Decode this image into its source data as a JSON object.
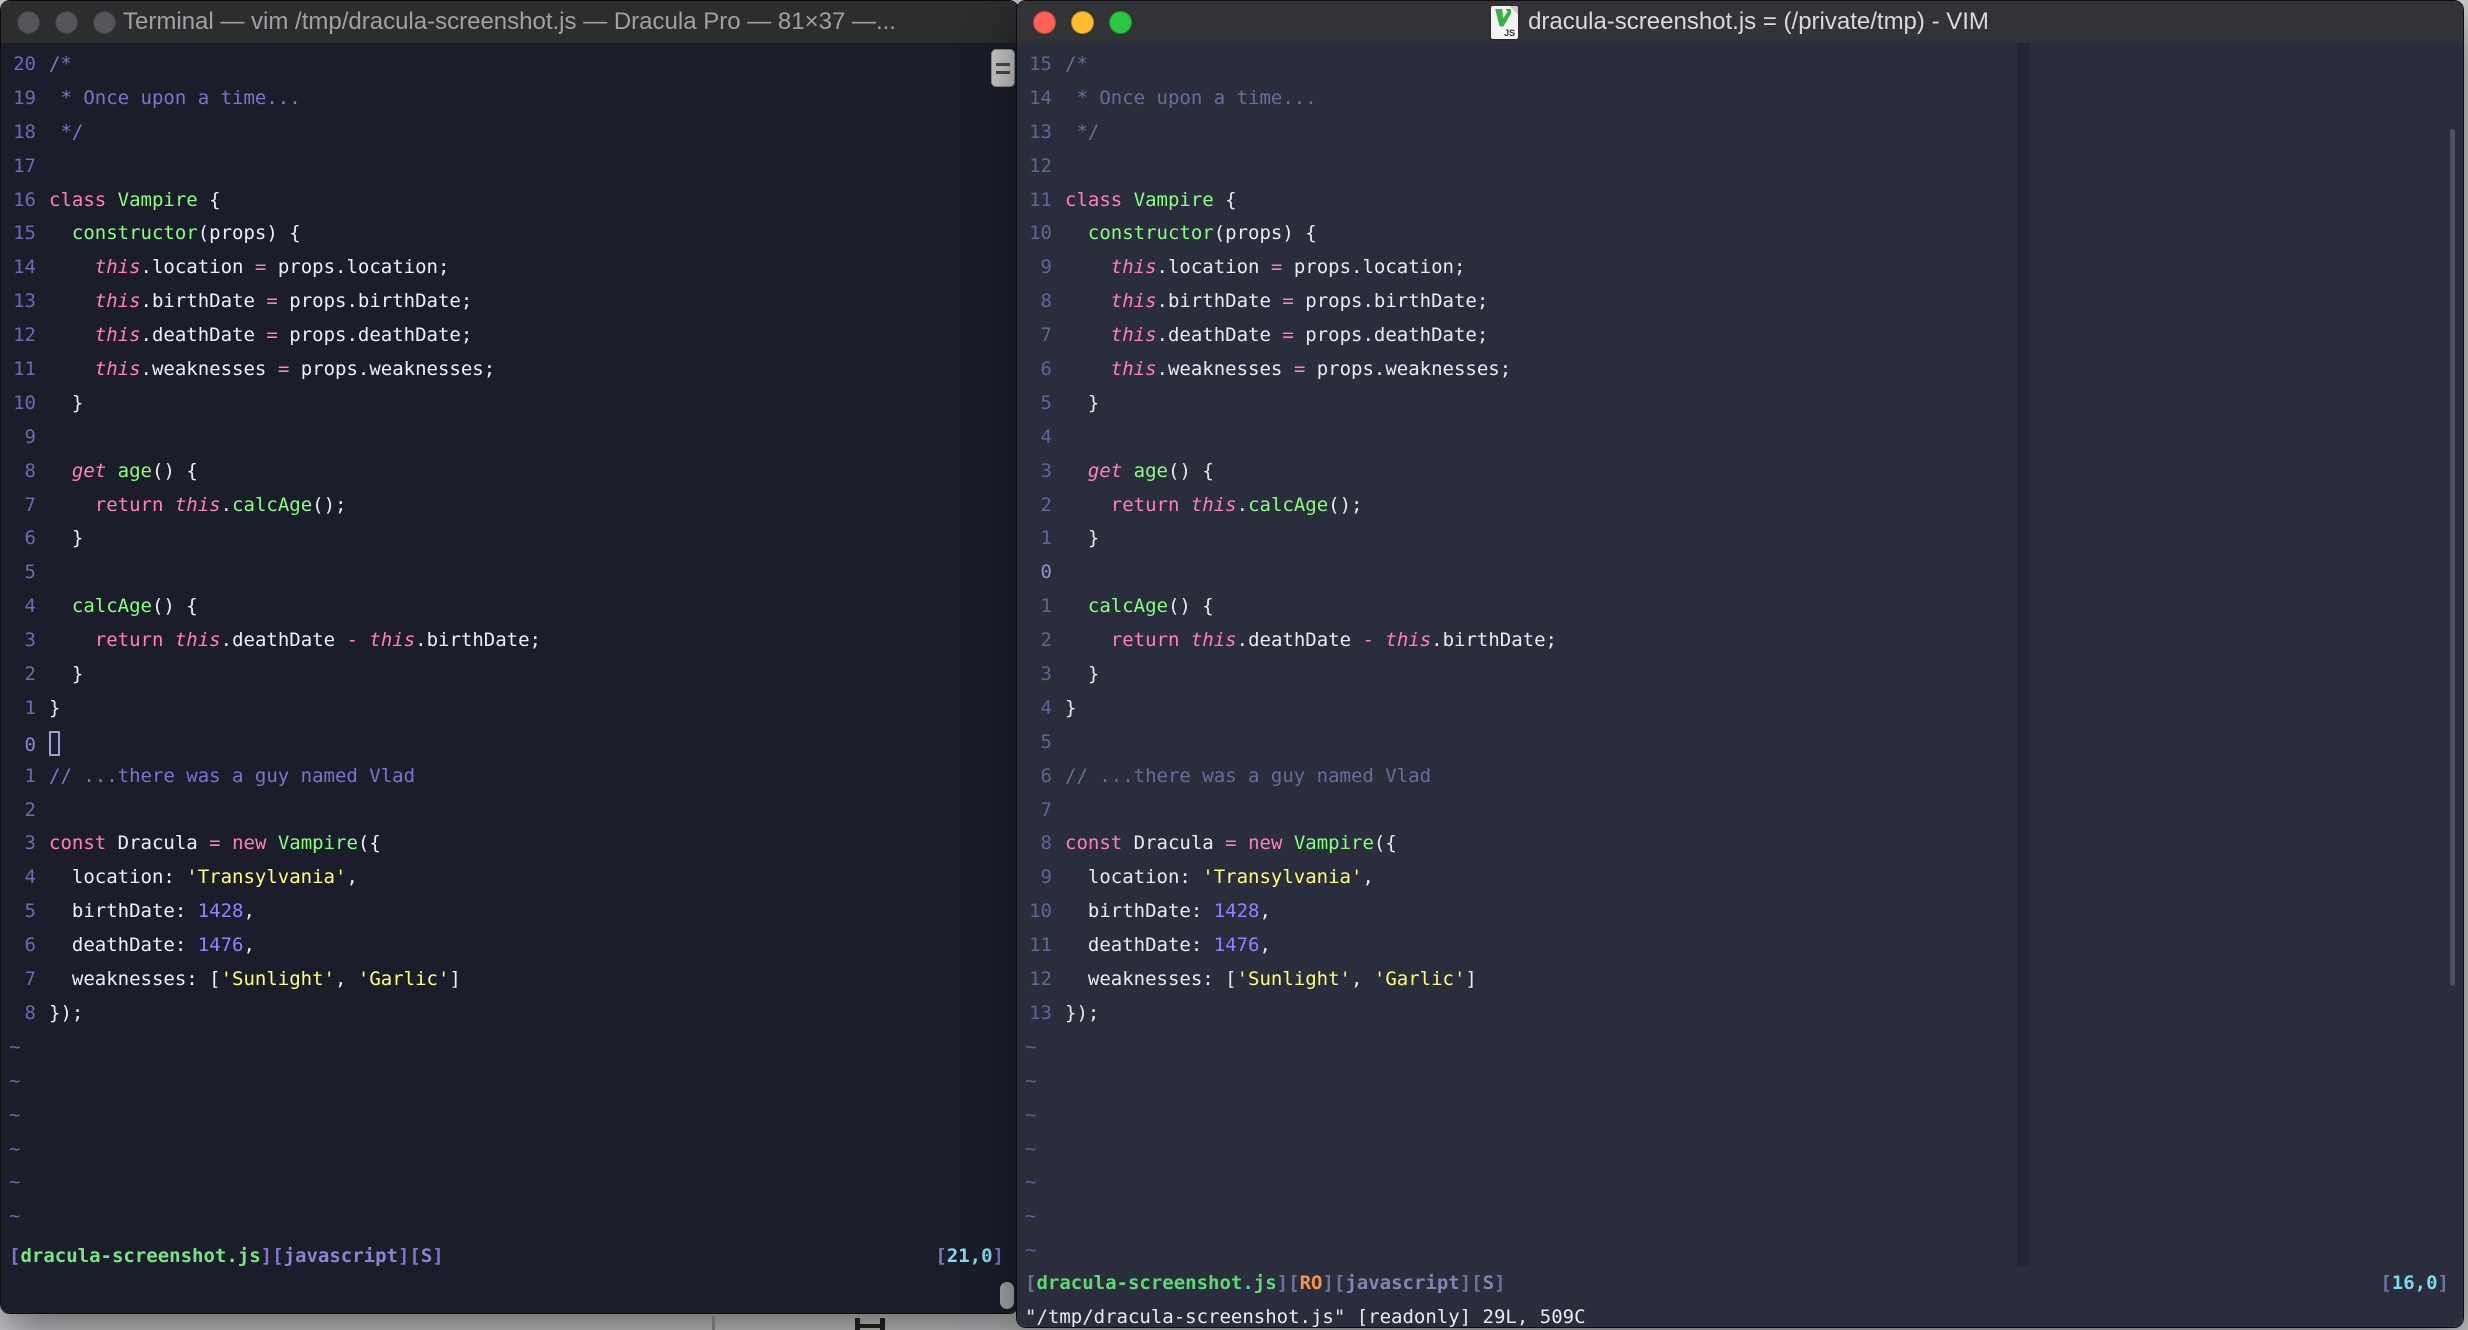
{
  "desktop": {
    "bg": "#cfd0d1"
  },
  "code": {
    "language": "javascript",
    "lines": [
      [
        [
          "c",
          "/*"
        ]
      ],
      [
        [
          "c",
          " * Once upon a time..."
        ]
      ],
      [
        [
          "c",
          " */"
        ]
      ],
      [],
      [
        [
          "k",
          "class"
        ],
        [
          "w",
          " "
        ],
        [
          "g",
          "Vampire"
        ],
        [
          "w",
          " {"
        ]
      ],
      [
        [
          "w",
          "  "
        ],
        [
          "g",
          "constructor"
        ],
        [
          "w",
          "(props) {"
        ]
      ],
      [
        [
          "w",
          "    "
        ],
        [
          "ki",
          "this"
        ],
        [
          "w",
          ".location "
        ],
        [
          "k",
          "="
        ],
        [
          "w",
          " props.location;"
        ]
      ],
      [
        [
          "w",
          "    "
        ],
        [
          "ki",
          "this"
        ],
        [
          "w",
          ".birthDate "
        ],
        [
          "k",
          "="
        ],
        [
          "w",
          " props.birthDate;"
        ]
      ],
      [
        [
          "w",
          "    "
        ],
        [
          "ki",
          "this"
        ],
        [
          "w",
          ".deathDate "
        ],
        [
          "k",
          "="
        ],
        [
          "w",
          " props.deathDate;"
        ]
      ],
      [
        [
          "w",
          "    "
        ],
        [
          "ki",
          "this"
        ],
        [
          "w",
          ".weaknesses "
        ],
        [
          "k",
          "="
        ],
        [
          "w",
          " props.weaknesses;"
        ]
      ],
      [
        [
          "w",
          "  }"
        ]
      ],
      [],
      [
        [
          "w",
          "  "
        ],
        [
          "ki",
          "get"
        ],
        [
          "w",
          " "
        ],
        [
          "g",
          "age"
        ],
        [
          "w",
          "() {"
        ]
      ],
      [
        [
          "w",
          "    "
        ],
        [
          "k",
          "return"
        ],
        [
          "w",
          " "
        ],
        [
          "ki",
          "this"
        ],
        [
          "w",
          "."
        ],
        [
          "g",
          "calcAge"
        ],
        [
          "w",
          "();"
        ]
      ],
      [
        [
          "w",
          "  }"
        ]
      ],
      [],
      [
        [
          "w",
          "  "
        ],
        [
          "g",
          "calcAge"
        ],
        [
          "w",
          "() {"
        ]
      ],
      [
        [
          "w",
          "    "
        ],
        [
          "k",
          "return"
        ],
        [
          "w",
          " "
        ],
        [
          "ki",
          "this"
        ],
        [
          "w",
          ".deathDate "
        ],
        [
          "k",
          "-"
        ],
        [
          "w",
          " "
        ],
        [
          "ki",
          "this"
        ],
        [
          "w",
          ".birthDate;"
        ]
      ],
      [
        [
          "w",
          "  }"
        ]
      ],
      [
        [
          "w",
          "}"
        ]
      ],
      [],
      [
        [
          "c",
          "// ...there was a guy named Vlad"
        ]
      ],
      [],
      [
        [
          "k",
          "const"
        ],
        [
          "w",
          " Dracula "
        ],
        [
          "k",
          "="
        ],
        [
          "w",
          " "
        ],
        [
          "k",
          "new"
        ],
        [
          "w",
          " "
        ],
        [
          "g",
          "Vampire"
        ],
        [
          "w",
          "({"
        ]
      ],
      [
        [
          "w",
          "  location: "
        ],
        [
          "s",
          "'Transylvania'"
        ],
        [
          "w",
          ","
        ]
      ],
      [
        [
          "w",
          "  birthDate: "
        ],
        [
          "n",
          "1428"
        ],
        [
          "w",
          ","
        ]
      ],
      [
        [
          "w",
          "  deathDate: "
        ],
        [
          "n",
          "1476"
        ],
        [
          "w",
          ","
        ]
      ],
      [
        [
          "w",
          "  weaknesses: ["
        ],
        [
          "s",
          "'Sunlight'"
        ],
        [
          "w",
          ", "
        ],
        [
          "s",
          "'Garlic'"
        ],
        [
          "w",
          "]"
        ]
      ],
      [
        [
          "w",
          "});"
        ]
      ]
    ]
  },
  "windows": [
    {
      "id": "left",
      "title": "Terminal — vim /tmp/dracula-screenshot.js — Dracula Pro — 81×37 —...",
      "traffic_lights": [
        "#545659",
        "#545659",
        "#545659"
      ],
      "rel_numbers": [
        "20",
        "19",
        "18",
        "17",
        "16",
        "15",
        "14",
        "13",
        "12",
        "11",
        "10",
        "9",
        "8",
        "7",
        "6",
        "5",
        "4",
        "3",
        "2",
        "1",
        "0",
        "1",
        "2",
        "3",
        "4",
        "5",
        "6",
        "7",
        "8"
      ],
      "cursor_row": 20,
      "show_cursor": true,
      "tildes": 6,
      "status": [
        [
          "br",
          "["
        ],
        [
          "file",
          "dracula-screenshot.js"
        ],
        [
          "br",
          "]["
        ],
        [
          "meta",
          "javascript"
        ],
        [
          "br",
          "]["
        ],
        [
          "meta",
          "S"
        ],
        [
          "br",
          "]"
        ]
      ],
      "coords": [
        [
          "br",
          "["
        ],
        [
          "cy",
          "21,0"
        ],
        [
          "br",
          "]"
        ]
      ],
      "palette": {
        "titlebg": "#2c2d2f",
        "titlefg": "#a0a1a3",
        "bg": "#1b1e2a",
        "fg": "#eef0f8",
        "comment": "#7c74cb",
        "ln": "#6f69b2",
        "lncur": "#8a84cf",
        "pink": "#ff80bf",
        "green": "#8aff80",
        "yellow": "#ffff80",
        "purple": "#9580ff",
        "cyan": "#82dcee",
        "tilde": "#6c66ab",
        "sbr": "#7d75cd",
        "sfile": "#77e584",
        "smeta": "#8b84d0",
        "sro": "#f0964f",
        "cursor": "#9aa2dd",
        "ccol": "#1b1e2a"
      }
    },
    {
      "id": "right",
      "title": "dracula-screenshot.js = (/private/tmp) - VIM",
      "traffic_lights": [
        "#ff5f57",
        "#febc2e",
        "#28c840"
      ],
      "rel_numbers": [
        "15",
        "14",
        "13",
        "12",
        "11",
        "10",
        "9",
        "8",
        "7",
        "6",
        "5",
        "4",
        "3",
        "2",
        "1",
        "0",
        "1",
        "2",
        "3",
        "4",
        "5",
        "6",
        "7",
        "8",
        "9",
        "10",
        "11",
        "12",
        "13"
      ],
      "cursor_row": 15,
      "show_cursor": false,
      "tildes": 7,
      "status": [
        [
          "br",
          "["
        ],
        [
          "file",
          "dracula-screenshot.js"
        ],
        [
          "br",
          "]["
        ],
        [
          "ro",
          "RO"
        ],
        [
          "br",
          "]["
        ],
        [
          "meta",
          "javascript"
        ],
        [
          "br",
          "]["
        ],
        [
          "meta",
          "S"
        ],
        [
          "br",
          "]"
        ]
      ],
      "coords": [
        [
          "br",
          "["
        ],
        [
          "cy",
          "16,0"
        ],
        [
          "br",
          "]"
        ]
      ],
      "cmdline": "\"/tmp/dracula-screenshot.js\" [readonly] 29L, 509C",
      "palette": {
        "titlebg": "#323337",
        "titlefg": "#d8d9db",
        "bg": "#2a2d3c",
        "fg": "#e9ebf4",
        "comment": "#657098",
        "ln": "#5d6792",
        "lncur": "#8b95c9",
        "pink": "#ff80bf",
        "green": "#8aff80",
        "yellow": "#fffb7d",
        "purple": "#9580ff",
        "cyan": "#7fd9ee",
        "tilde": "#596490",
        "sbr": "#6b7499",
        "sfile": "#5fd878",
        "smeta": "#7e87b0",
        "sro": "#f0964f",
        "cursor": "#e9ebf4",
        "ccol": "#222534"
      }
    }
  ],
  "icons": {
    "doc_icon_label": "JS"
  }
}
